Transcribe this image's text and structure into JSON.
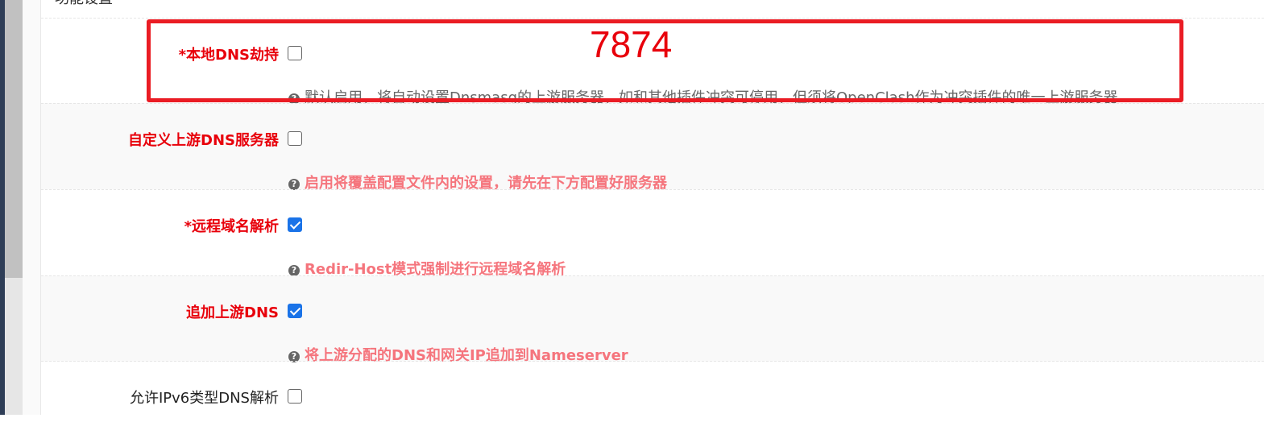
{
  "section": {
    "title": "功能设置"
  },
  "annotation": {
    "number": "7874",
    "color": "#ea1c24"
  },
  "rows": [
    {
      "label": "*本地DNS劫持",
      "checked": false,
      "help": "默认启用，将自动设置Dnsmasq的上游服务器，如和其他插件冲突可停用，但须将OpenClash作为冲突插件的唯一上游服务器"
    },
    {
      "label": "自定义上游DNS服务器",
      "checked": false,
      "help": "启用将覆盖配置文件内的设置，请先在下方配置好服务器"
    },
    {
      "label": "*远程域名解析",
      "checked": true,
      "help": "Redir-Host模式强制进行远程域名解析"
    },
    {
      "label": "追加上游DNS",
      "checked": true,
      "help": "将上游分配的DNS和网关IP追加到Nameserver"
    },
    {
      "label": "允许IPv6类型DNS解析",
      "checked": false
    }
  ],
  "help_icon": "question-circle-icon",
  "colors": {
    "label_red": "#e8000b",
    "help_red": "#f5757d",
    "checkbox_blue": "#1a73e8"
  }
}
